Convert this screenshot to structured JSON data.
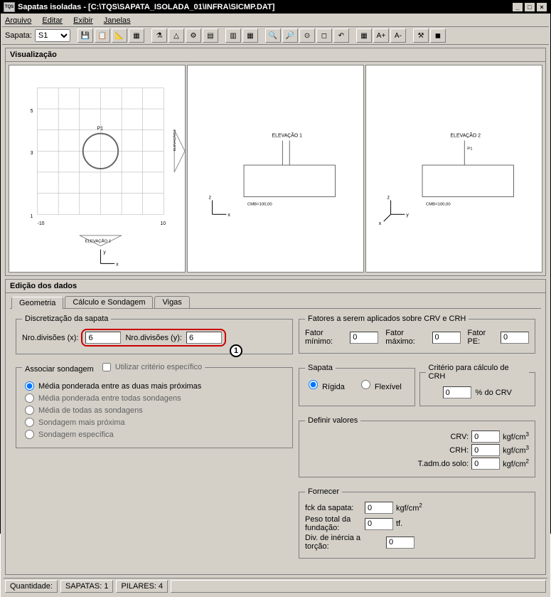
{
  "window": {
    "app_icon_text": "TQS",
    "title": "Sapatas isoladas -  [C:\\TQS\\SAPATA_ISOLADA_01\\INFRA\\SICMP.DAT]"
  },
  "menu": {
    "arquivo": "Arquivo",
    "editar": "Editar",
    "exibir": "Exibir",
    "janelas": "Janelas"
  },
  "toolbar": {
    "sapata_label": "Sapata:",
    "sapata_value": "S1"
  },
  "sections": {
    "visualizacao": "Visualização",
    "edicao": "Edição dos dados"
  },
  "viz": {
    "planta_label": "ELEVAÇÃO 1",
    "planta_side": "ELEVAÇÃO 2",
    "elev1": "ELEVAÇÃO 1",
    "elev2": "ELEVAÇÃO 2",
    "cmb": "CMB=100,00",
    "x": "x",
    "y": "y",
    "z": "z",
    "pillar": "P1"
  },
  "tabs": {
    "geom": "Geometria",
    "calc": "Cálculo e Sondagem",
    "vigas": "Vigas"
  },
  "discret": {
    "legend": "Discretização da sapata",
    "nx_label": "Nro.divisões (x):",
    "nx_value": "6",
    "ny_label": "Nro.divisões (y):",
    "ny_value": "6"
  },
  "assoc": {
    "legend": "Associar sondagem",
    "chk": "Utilizar critério específico",
    "r1": "Média ponderada entre as duas mais próximas",
    "r2": "Média ponderada entre todas sondagens",
    "r3": "Média de todas as sondagens",
    "r4": "Sondagem mais próxima",
    "r5": "Sondagem específica"
  },
  "fatores": {
    "legend": "Fatores a serem aplicados sobre CRV e CRH",
    "min_label": "Fator mínimo:",
    "min_value": "0",
    "max_label": "Fator máximo:",
    "max_value": "0",
    "pe_label": "Fator PE:",
    "pe_value": "0"
  },
  "sapata_type": {
    "legend": "Sapata",
    "rigida": "Rígida",
    "flexivel": "Flexível"
  },
  "crh": {
    "legend": "Critério para cálculo de CRH",
    "value": "0",
    "unit": "% do CRV"
  },
  "definir": {
    "legend": "Definir valores",
    "crv_label": "CRV:",
    "crv_value": "0",
    "crv_unit": "kgf/cm³",
    "crh_label": "CRH:",
    "crh_value": "0",
    "crh_unit": "kgf/cm³",
    "tadm_label": "T.adm.do solo:",
    "tadm_value": "0",
    "tadm_unit": "kgf/cm²"
  },
  "fornecer": {
    "legend": "Fornecer",
    "fck_label": "fck da sapata:",
    "fck_value": "0",
    "fck_unit": "kgf/cm²",
    "peso_label": "Peso total da fundação:",
    "peso_value": "0",
    "peso_unit": "tf.",
    "div_label": "Div. de inércia a torção:",
    "div_value": "0"
  },
  "status": {
    "quant": "Quantidade:",
    "sapatas": "SAPATAS: 1",
    "pilares": "PILARES: 4"
  },
  "annot": {
    "one": "1"
  }
}
